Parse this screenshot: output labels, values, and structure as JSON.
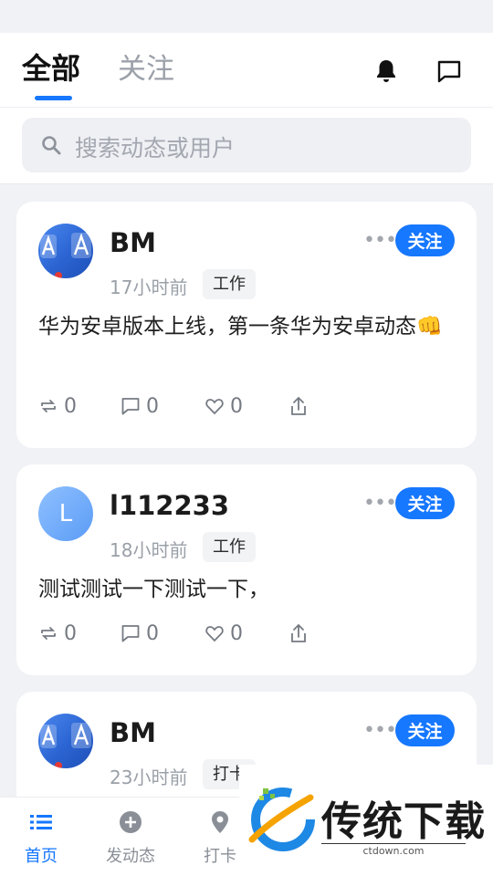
{
  "header": {
    "tabs": [
      {
        "label": "全部",
        "active": true
      },
      {
        "label": "关注",
        "active": false
      }
    ],
    "icons": [
      "bell-icon",
      "message-icon"
    ]
  },
  "search": {
    "placeholder": "搜索动态或用户"
  },
  "feed": [
    {
      "avatar": "app-store-icon",
      "name": "BM",
      "time": "17小时前",
      "tag": "工作",
      "follow": "关注",
      "content": "华为安卓版本上线，第一条华为安卓动态👊",
      "repost": "0",
      "comment": "0",
      "like": "0"
    },
    {
      "avatar_letter": "L",
      "name": "l112233",
      "time": "18小时前",
      "tag": "工作",
      "follow": "关注",
      "content": "测试测试一下测试一下，",
      "repost": "0",
      "comment": "0",
      "like": "0"
    },
    {
      "avatar": "app-store-icon",
      "name": "BM",
      "time": "23小时前",
      "tag": "打卡",
      "follow": "关注"
    }
  ],
  "tabbar": [
    {
      "label": "首页",
      "icon": "list-icon",
      "active": true
    },
    {
      "label": "发动态",
      "icon": "plus-circle-icon",
      "active": false
    },
    {
      "label": "打卡",
      "icon": "location-icon",
      "active": false
    }
  ],
  "watermark": {
    "brand": "传统下载",
    "url": "ctdown.com"
  },
  "colors": {
    "accent": "#1677ff",
    "background": "#f1f2f6"
  }
}
